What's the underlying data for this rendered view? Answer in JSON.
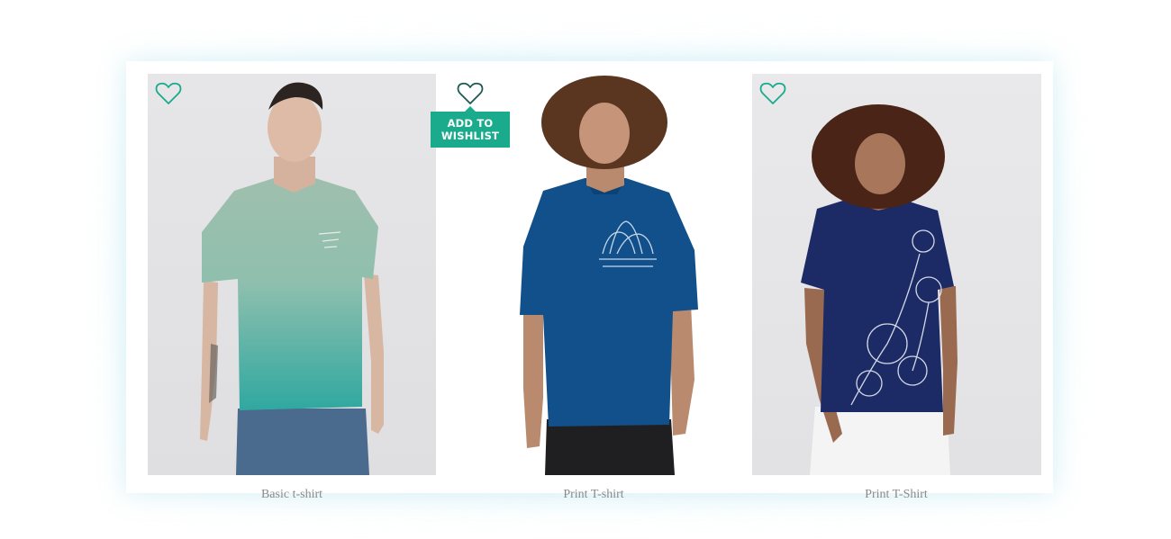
{
  "products": [
    {
      "caption": "Basic t-shirt",
      "wishlist_icon": "heart-outline-icon"
    },
    {
      "caption": "Print T-shirt",
      "wishlist_icon": "heart-outline-icon"
    },
    {
      "caption": "Print T-Shirt",
      "wishlist_icon": "heart-outline-icon"
    }
  ],
  "tooltip": {
    "line1": "ADD TO",
    "line2": "WISHLIST"
  },
  "colors": {
    "accent": "#1aaa8c",
    "heart_stroke": "#1aaa8c"
  }
}
